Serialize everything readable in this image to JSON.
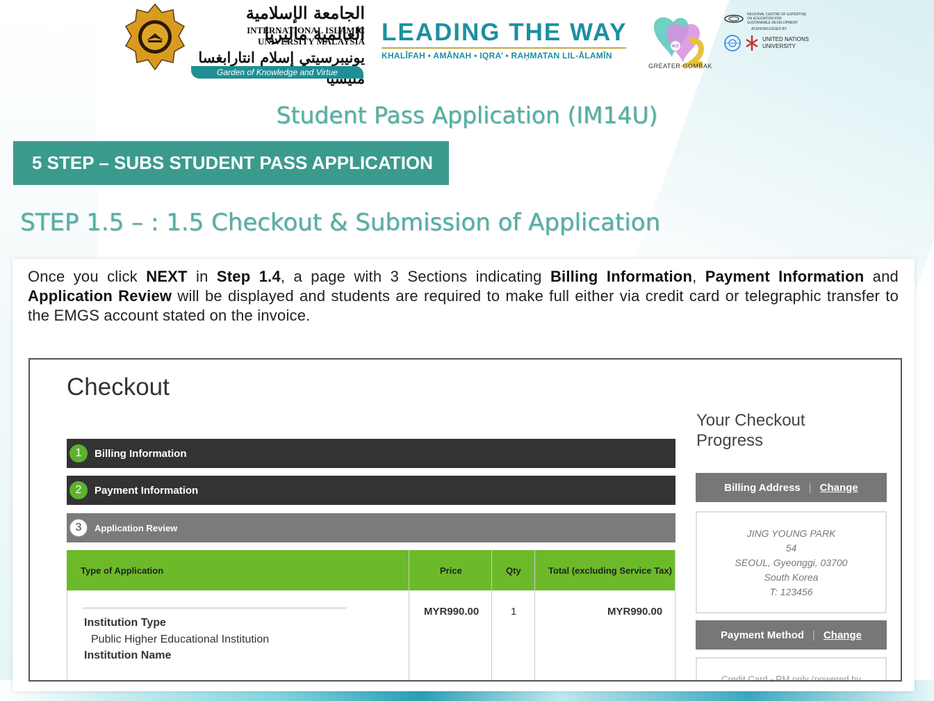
{
  "header": {
    "iium_arabic": "الجامعة الإسلامية العالمية ماليزيا",
    "iium_english": "INTERNATIONAL ISLAMIC UNIVERSITY MALAYSIA",
    "iium_malay": "يونيبرسيتي إسلام انتارابغسا مليسيا",
    "iium_tagline": "Garden of Knowledge and Virtue",
    "leading_title": "LEADING THE WAY",
    "leading_sub": "KHALĪFAH • AMĀNAH • IQRA’ • RAḤMATAN LIL-ĀLAMĪN",
    "rce_label": "GREATER GOMBAK",
    "rce_badge": "RCE",
    "rce_lines": [
      "REGIONAL CENTRE OF EXPERTISE",
      "ON EDUCATION FOR",
      "SUSTAINABLE DEVELOPMENT"
    ],
    "acknowledged": "ACKNOWLEDGED BY",
    "un_lines": [
      "UNITED NATIONS",
      "UNIVERSITY"
    ]
  },
  "slide": {
    "title": "Student Pass Application (IM14U)",
    "banner": "5 STEP – SUBS STUDENT PASS APPLICATION",
    "step_title": "STEP 1.5 – : 1.5 Checkout & Submission of Application"
  },
  "intro": {
    "p1": "Once you click ",
    "b1": "NEXT",
    "p2": " in ",
    "b2": "Step 1.4",
    "p3": ", a page with 3 Sections indicating ",
    "b3": "Billing Information",
    "p4": ", ",
    "b4": "Payment Information",
    "p5": " and ",
    "b5": "Application Review",
    "p6": " will be displayed and students are required to make full either via credit card or telegraphic transfer to the EMGS account stated on the invoice."
  },
  "checkout": {
    "title": "Checkout",
    "sections": [
      {
        "num": "1",
        "label": "Billing Information"
      },
      {
        "num": "2",
        "label": "Payment Information"
      },
      {
        "num": "3",
        "label": "Application Review"
      }
    ],
    "table": {
      "headers": [
        "Type of Application",
        "Price",
        "Qty",
        "Total (excluding Service Tax)"
      ],
      "price": "MYR990.00",
      "qty": "1",
      "total": "MYR990.00",
      "institution_type_label": "Institution Type",
      "institution_type_value": "Public Higher Educational Institution",
      "institution_name_label": "Institution Name"
    },
    "progress": {
      "title_line1": "Your Checkout",
      "title_line2": "Progress",
      "billing_label": "Billing Address",
      "billing_change": "Change",
      "address": [
        "JING YOUNG PARK",
        "54",
        "SEOUL, Gyeonggi, 03700",
        "South Korea",
        "T: 123456"
      ],
      "payment_label": "Payment Method",
      "payment_change": "Change",
      "payment_text": "Credit Card - RM only (powered by"
    }
  }
}
